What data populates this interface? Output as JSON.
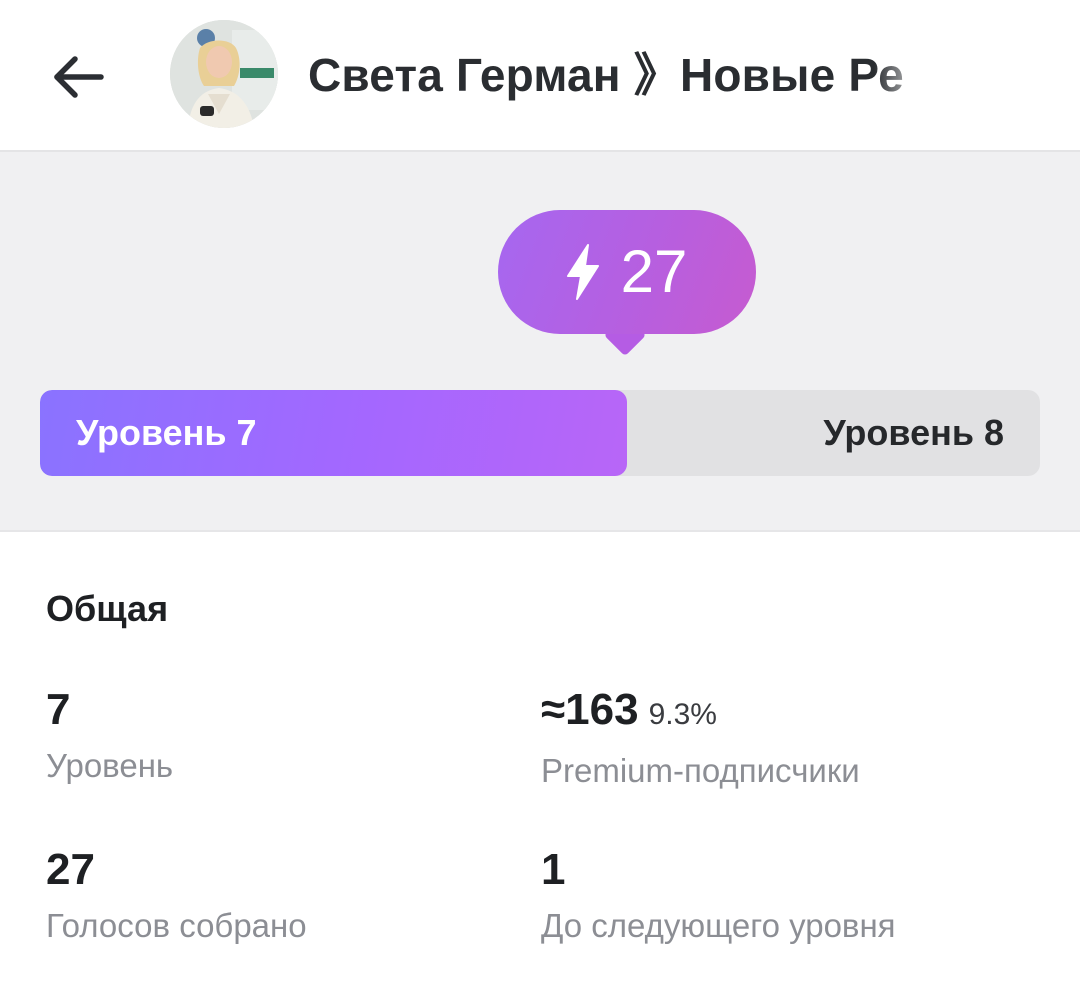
{
  "header": {
    "title": "Света Герман 》Новые Ре",
    "back_icon": "arrow-left-icon",
    "avatar_icon": "channel-avatar"
  },
  "boost": {
    "count": "27",
    "bolt_icon": "lightning-bolt-icon",
    "current_level_label": "Уровень 7",
    "next_level_label": "Уровень 8",
    "progress_fraction": 0.587,
    "colors": {
      "bubble": "#b35fe4",
      "fill_start": "#8a73ff",
      "fill_end": "#b866f7",
      "track": "#e1e1e3"
    }
  },
  "stats": {
    "section_title": "Общая",
    "items": [
      {
        "value": "7",
        "extra": "",
        "label": "Уровень"
      },
      {
        "value": "≈163",
        "extra": "9.3%",
        "label": "Premium-подписчики"
      },
      {
        "value": "27",
        "extra": "",
        "label": "Голосов собрано"
      },
      {
        "value": "1",
        "extra": "",
        "label": "До следующего уровня"
      }
    ]
  }
}
